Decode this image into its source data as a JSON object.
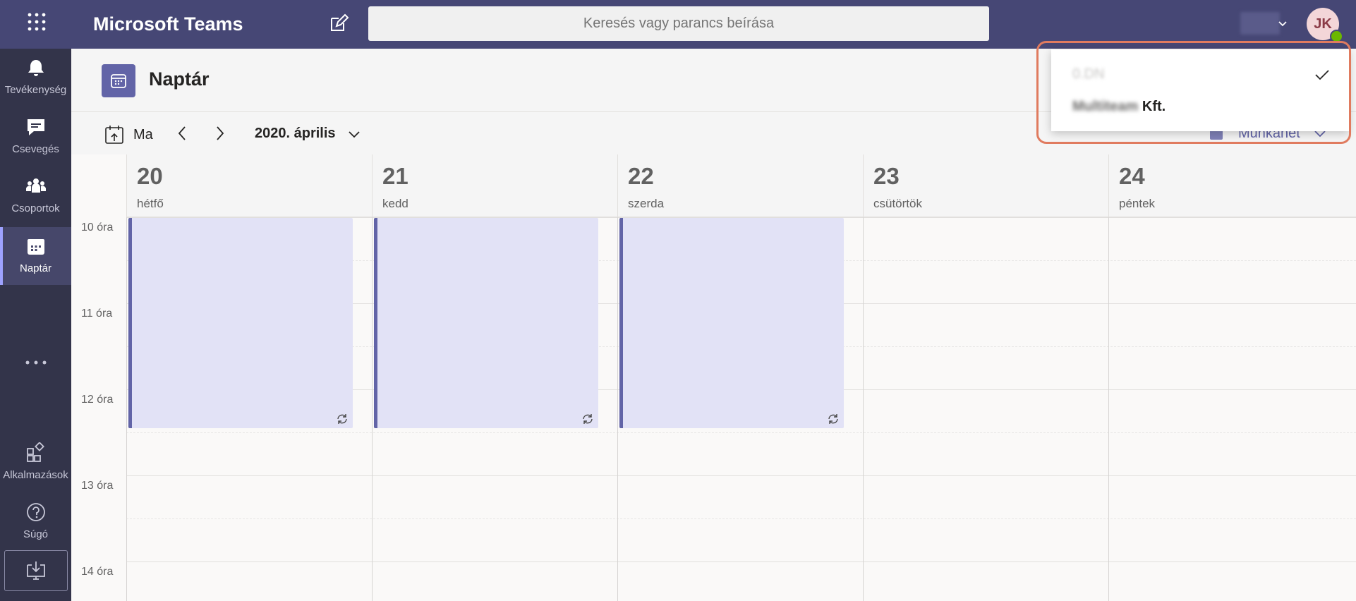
{
  "topbar": {
    "app_title": "Microsoft Teams",
    "search_placeholder": "Keresés vagy parancs beírása",
    "avatar_initials": "JK",
    "accent": "#464775"
  },
  "rail": {
    "items": [
      {
        "label": "Tevékenység",
        "icon": "bell-icon"
      },
      {
        "label": "Csevegés",
        "icon": "chat-icon"
      },
      {
        "label": "Csoportok",
        "icon": "teams-icon"
      },
      {
        "label": "Naptár",
        "icon": "calendar-icon",
        "active": true
      },
      {
        "label": "Alkalmazások",
        "icon": "apps-icon"
      },
      {
        "label": "Súgó",
        "icon": "help-icon"
      }
    ]
  },
  "header": {
    "title": "Naptár"
  },
  "toolbar": {
    "today_label": "Ma",
    "month_label": "2020. április",
    "view_label": "Munkahét"
  },
  "calendar": {
    "days": [
      {
        "num": "20",
        "name": "hétfő"
      },
      {
        "num": "21",
        "name": "kedd"
      },
      {
        "num": "22",
        "name": "szerda"
      },
      {
        "num": "23",
        "name": "csütörtök"
      },
      {
        "num": "24",
        "name": "péntek"
      }
    ],
    "hours": [
      "10 óra",
      "11 óra",
      "12 óra",
      "13 óra",
      "14 óra"
    ],
    "event_color": "#e2e2f6"
  },
  "popup": {
    "row1_text": "0.DN",
    "row2_blurred": "Multiteam",
    "row2_text": "Kft."
  }
}
